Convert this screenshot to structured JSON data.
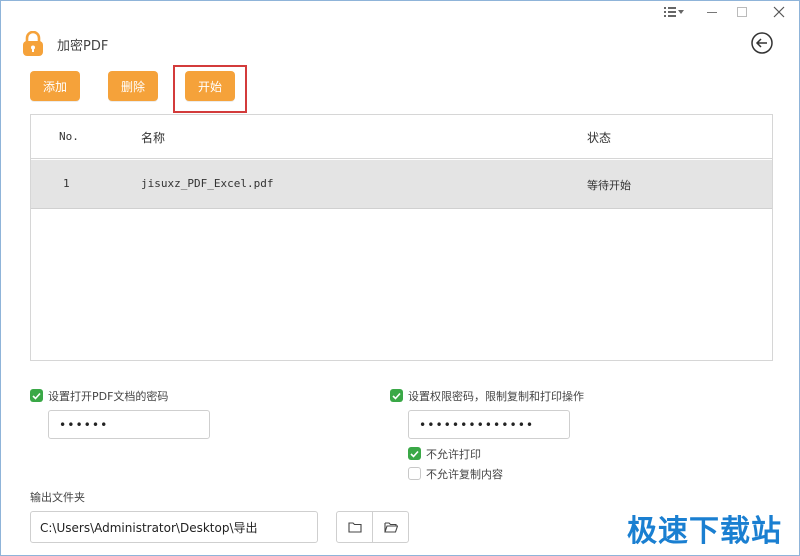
{
  "header": {
    "app_title": "加密PDF"
  },
  "toolbar": {
    "add_label": "添加",
    "delete_label": "删除",
    "start_label": "开始"
  },
  "table": {
    "columns": [
      "No.",
      "名称",
      "状态"
    ],
    "rows": [
      {
        "no": "1",
        "name": "jisuxz_PDF_Excel.pdf",
        "status": "等待开始"
      }
    ]
  },
  "open_password": {
    "checked": true,
    "label": "设置打开PDF文档的密码",
    "value": "••••••"
  },
  "permission_password": {
    "checked": true,
    "label": "设置权限密码，限制复制和打印操作",
    "value": "••••••••••••••",
    "options": [
      {
        "label": "不允许打印",
        "checked": true
      },
      {
        "label": "不允许复制内容",
        "checked": false
      }
    ]
  },
  "output": {
    "label": "输出文件夹",
    "path": "C:\\Users\\Administrator\\Desktop\\导出"
  },
  "watermark": "极速下载站",
  "colors": {
    "accent_orange": "#f5a23a",
    "check_green": "#3aa847",
    "highlight_red": "#d33b3b",
    "watermark_blue": "#1a7fd1"
  }
}
